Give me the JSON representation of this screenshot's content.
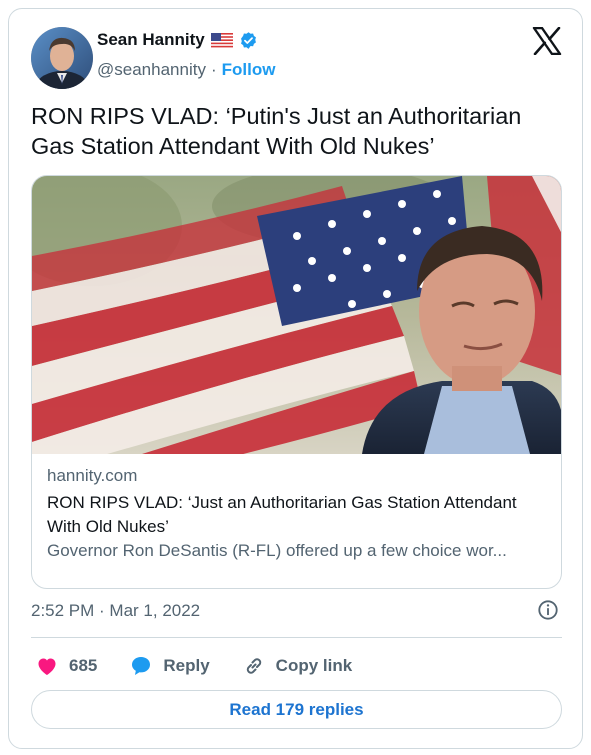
{
  "author": {
    "name": "Sean Hannity",
    "handle": "@seanhannity",
    "separator": "·",
    "follow_label": "Follow"
  },
  "tweet": {
    "text": "RON RIPS VLAD: ‘Putin's Just an Authoritarian Gas Station Attendant With Old Nukes’"
  },
  "link_card": {
    "domain": "hannity.com",
    "title": "RON RIPS VLAD: ‘Just an Authoritarian Gas Station Attendant With Old Nukes’",
    "description": "Governor Ron DeSantis (R-FL) offered up a few choice wor..."
  },
  "timestamp": "2:52 PM · Mar 1, 2022",
  "actions": {
    "like_count": "685",
    "reply_label": "Reply",
    "copy_label": "Copy link"
  },
  "read_replies_label": "Read 179 replies",
  "colors": {
    "accent": "#1d9bf0",
    "heart": "#f91880",
    "reply_blue": "#1d9bf0",
    "border": "#cfd9de",
    "muted": "#536471"
  },
  "icons": {
    "flag": "us-flag-icon",
    "verified": "verified-badge-icon",
    "logo": "x-logo-icon",
    "info": "info-icon",
    "like": "heart-icon",
    "reply": "speech-bubble-icon",
    "copy": "link-icon"
  }
}
